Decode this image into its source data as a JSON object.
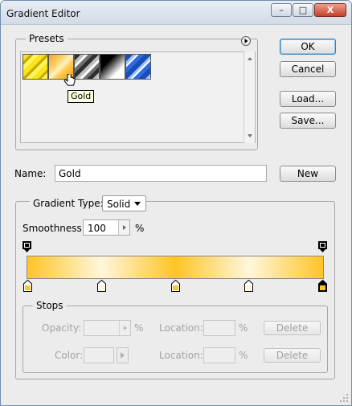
{
  "window": {
    "title": "Gradient Editor"
  },
  "titlebar_buttons": {
    "minimize": "–",
    "maximize": "□",
    "close": "X"
  },
  "presets": {
    "label": "Presets",
    "tooltip": "Gold",
    "swatches": [
      "yellow-diagonal",
      "gold",
      "silver-diagonal",
      "black-white",
      "blue-diagonal"
    ]
  },
  "buttons": {
    "ok": "OK",
    "cancel": "Cancel",
    "load": "Load...",
    "save": "Save...",
    "new": "New"
  },
  "name_field": {
    "label": "Name:",
    "value": "Gold"
  },
  "gradient_type": {
    "label": "Gradient Type:",
    "value": "Solid"
  },
  "smoothness": {
    "label": "Smoothness:",
    "value": "100",
    "unit": "%"
  },
  "gradient": {
    "colors": {
      "gold": "#ffc426",
      "light": "#fff6dc"
    },
    "color_stop_positions": [
      0,
      25,
      50,
      75,
      100
    ]
  },
  "stops": {
    "label": "Stops",
    "opacity_label": "Opacity:",
    "opacity_unit": "%",
    "location_label": "Location:",
    "location_unit": "%",
    "color_label": "Color:",
    "delete_label": "Delete"
  }
}
